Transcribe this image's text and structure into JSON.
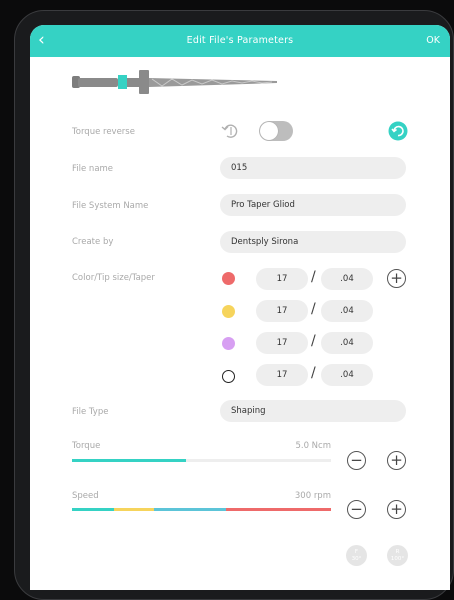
{
  "header": {
    "back_glyph": "‹",
    "title": "Edit File's Parameters",
    "ok_label": "OK"
  },
  "colors": {
    "accent": "#35d2c4",
    "red": "#ee6a6a",
    "yellow": "#f6d45c",
    "purple": "#d79ff2",
    "blue": "#5cc4d8"
  },
  "torque_reverse": {
    "label": "Torque reverse",
    "enabled": false,
    "reset_icon": "rotate-left-icon",
    "apply_icon": "rotate-cw-icon"
  },
  "file_name": {
    "label": "File name",
    "value": "015"
  },
  "file_system": {
    "label": "File System Name",
    "value": "Pro Taper Gliod"
  },
  "create_by": {
    "label": "Create by",
    "value": "Dentsply Sirona"
  },
  "color_tip": {
    "label": "Color/Tip size/Taper",
    "rows": [
      {
        "color": "red",
        "tip": "17",
        "taper": ".04"
      },
      {
        "color": "yellow",
        "tip": "17",
        "taper": ".04"
      },
      {
        "color": "purple",
        "tip": "17",
        "taper": ".04"
      },
      {
        "color": "white",
        "tip": "17",
        "taper": ".04"
      }
    ],
    "separator": "/"
  },
  "file_type": {
    "label": "File Type",
    "value": "Shaping"
  },
  "torque": {
    "label": "Torque",
    "value": "5.0 Ncm",
    "level": 0.44
  },
  "speed": {
    "label": "Speed",
    "value": "300 rpm"
  },
  "buttons": {
    "minus": "−",
    "plus": "+"
  },
  "angle_buttons": [
    {
      "top": "F",
      "bottom": "30°"
    },
    {
      "top": "R",
      "bottom": "100°"
    }
  ]
}
